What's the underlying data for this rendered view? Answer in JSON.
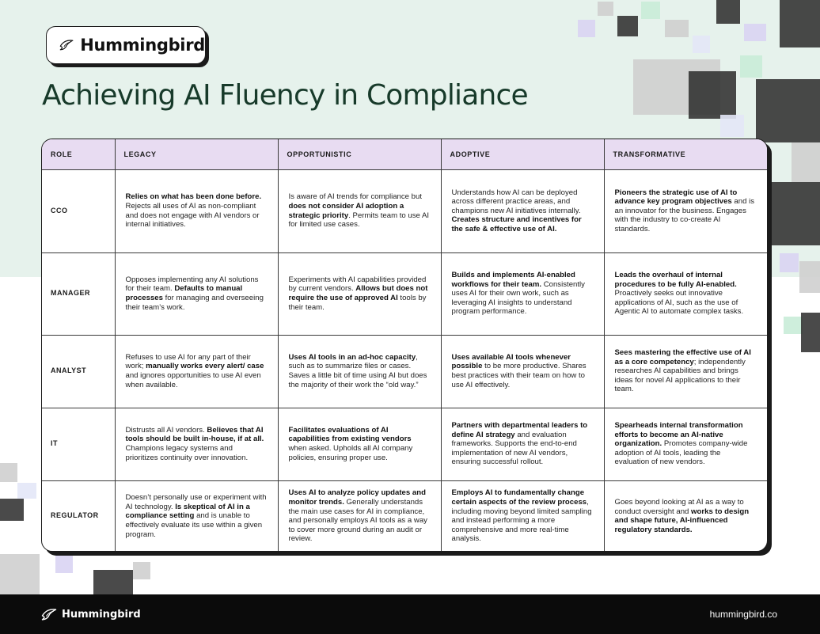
{
  "brand": {
    "name": "Hummingbird",
    "icon": "hummingbird-icon"
  },
  "title": "Achieving AI Fluency in Compliance",
  "table": {
    "headers": [
      "ROLE",
      "LEGACY",
      "OPPORTUNISTIC",
      "ADOPTIVE",
      "TRANSFORMATIVE"
    ],
    "rows": [
      {
        "role": "CCO",
        "cells": [
          [
            {
              "b": "Relies on what has been done before."
            },
            {
              "t": " Rejects all uses of AI as non-compliant and does not engage with AI vendors or internal initiatives."
            }
          ],
          [
            {
              "t": "Is aware of AI trends for compliance but "
            },
            {
              "b": "does not consider AI adoption a strategic priority"
            },
            {
              "t": ". Permits team to use AI for limited use cases."
            }
          ],
          [
            {
              "t": "Understands how AI can be deployed across different practice areas, and champions new AI initiatives internally. "
            },
            {
              "b": "Creates structure and incentives for the safe & effective use of AI."
            }
          ],
          [
            {
              "b": "Pioneers the strategic use of AI to advance key program objectives"
            },
            {
              "t": " and is an innovator for the business. Engages with the industry to co-create AI standards."
            }
          ]
        ]
      },
      {
        "role": "MANAGER",
        "cells": [
          [
            {
              "t": "Opposes implementing any AI solutions for their team. "
            },
            {
              "b": "Defaults to manual processes"
            },
            {
              "t": " for managing and overseeing their team’s work."
            }
          ],
          [
            {
              "t": "Experiments with AI capabilities provided by current vendors. "
            },
            {
              "b": "Allows but does not require the use of approved AI"
            },
            {
              "t": " tools by their team."
            }
          ],
          [
            {
              "b": "Builds and implements AI-enabled workflows for their team."
            },
            {
              "t": " Consistently uses AI for their own work, such as leveraging AI insights to understand program performance."
            }
          ],
          [
            {
              "b": "Leads the overhaul of internal procedures to be fully AI-enabled."
            },
            {
              "t": " Proactively seeks out innovative applications of AI, such as the use of Agentic AI to automate complex tasks."
            }
          ]
        ]
      },
      {
        "role": "ANALYST",
        "cells": [
          [
            {
              "t": "Refuses to use AI for any part of their work; "
            },
            {
              "b": "manually works every alert/ case"
            },
            {
              "t": " and ignores opportunities to use AI even when available."
            }
          ],
          [
            {
              "b": "Uses AI tools in an ad-hoc capacity"
            },
            {
              "t": ", such as to summarize files or cases. Saves a little bit of time using AI but does the majority of their work the “old way.”"
            }
          ],
          [
            {
              "b": "Uses available AI tools whenever possible"
            },
            {
              "t": " to be more productive. Shares best practices with their team on how to use AI effectively."
            }
          ],
          [
            {
              "b": "Sees mastering the effective use of AI as a core competency"
            },
            {
              "t": "; independently researches AI capabilities and brings ideas for novel AI applications to their team."
            }
          ]
        ]
      },
      {
        "role": "IT",
        "cells": [
          [
            {
              "t": "Distrusts all AI vendors. "
            },
            {
              "b": "Believes that AI tools should be built in-house, if at all."
            },
            {
              "t": " Champions legacy systems and prioritizes continuity over innovation."
            }
          ],
          [
            {
              "b": "Facilitates evaluations of AI capabilities from existing vendors"
            },
            {
              "t": " when asked. Upholds all AI company policies, ensuring proper use."
            }
          ],
          [
            {
              "b": "Partners with departmental leaders to define AI strategy"
            },
            {
              "t": " and evaluation frameworks. Supports the end-to-end implementation of new AI vendors, ensuring successful rollout."
            }
          ],
          [
            {
              "b": "Spearheads internal transformation efforts to become an AI-native organization."
            },
            {
              "t": " Promotes company-wide adoption of AI tools, leading the evaluation of new vendors."
            }
          ]
        ]
      },
      {
        "role": "REGULATOR",
        "cells": [
          [
            {
              "t": "Doesn’t personally use or experiment with AI technology. "
            },
            {
              "b": "Is skeptical of AI in a compliance setting"
            },
            {
              "t": " and is unable to effectively evaluate its use within a given program."
            }
          ],
          [
            {
              "b": "Uses AI to analyze policy updates and monitor trends."
            },
            {
              "t": " Generally understands the main use cases for AI in compliance, and personally employs AI tools as a way to cover more ground during an audit or review."
            }
          ],
          [
            {
              "b": "Employs AI to fundamentally change certain aspects of the review process"
            },
            {
              "t": ", including moving beyond limited sampling and instead performing a more comprehensive and more real-time analysis."
            }
          ],
          [
            {
              "t": "Goes beyond looking at AI as a way to conduct oversight and "
            },
            {
              "b": "works to design and shape future, AI-influenced regulatory standards."
            }
          ]
        ]
      }
    ]
  },
  "footer": {
    "brand": "Hummingbird",
    "url": "hummingbird.co"
  },
  "colors": {
    "hero_bg": "#e6f2ec",
    "title": "#173a2a",
    "header_row": "#e8dcf2",
    "footer_bg": "#0b0b0b"
  }
}
